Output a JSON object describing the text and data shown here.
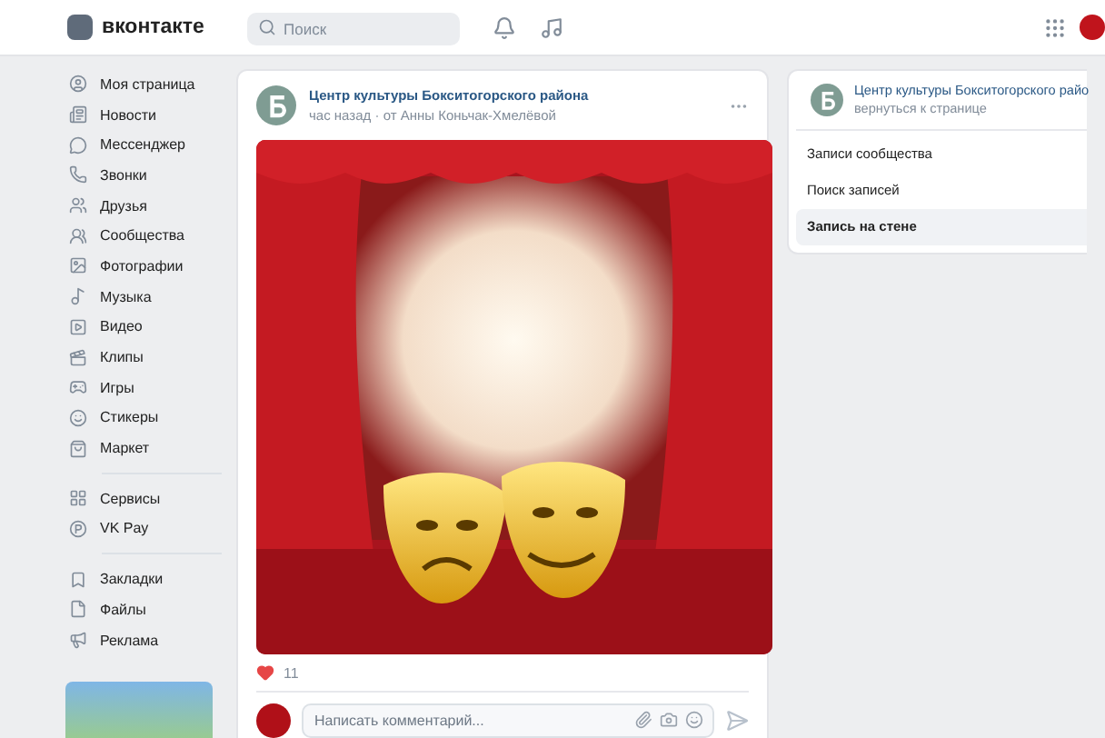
{
  "header": {
    "brand": "вконтакте",
    "search": {
      "placeholder": "Поиск"
    }
  },
  "sidebar": {
    "groups": [
      [
        {
          "label": "Моя страница"
        },
        {
          "label": "Новости"
        },
        {
          "label": "Мессенджер"
        },
        {
          "label": "Звонки"
        },
        {
          "label": "Друзья"
        },
        {
          "label": "Сообщества"
        },
        {
          "label": "Фотографии"
        },
        {
          "label": "Музыка"
        },
        {
          "label": "Видео"
        },
        {
          "label": "Клипы"
        },
        {
          "label": "Игры"
        },
        {
          "label": "Стикеры"
        },
        {
          "label": "Маркет"
        }
      ],
      [
        {
          "label": "Сервисы"
        },
        {
          "label": "VK Pay"
        }
      ],
      [
        {
          "label": "Закладки"
        },
        {
          "label": "Файлы"
        },
        {
          "label": "Реклама"
        }
      ]
    ]
  },
  "post": {
    "author": "Центр культуры Бокситогорского района",
    "time": "час назад",
    "separator": "·",
    "by": "от Анны Коньчак-Хмелёвой",
    "likes": "11",
    "liked": true,
    "comment": {
      "placeholder": "Написать комментарий..."
    }
  },
  "side_panel": {
    "community": "Центр культуры Бокситогорского райо",
    "back_link": "вернуться к странице",
    "menu": [
      {
        "label": "Записи сообщества",
        "selected": false
      },
      {
        "label": "Поиск записей",
        "selected": false
      },
      {
        "label": "Запись на стене",
        "selected": true
      }
    ]
  }
}
